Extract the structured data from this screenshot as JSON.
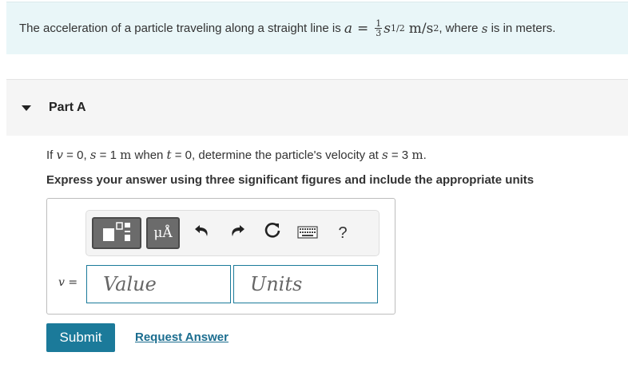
{
  "intro": {
    "prefix": "The acceleration of a particle traveling along a straight line is",
    "eq_var": "a",
    "eq_sign": "=",
    "frac_num": "1",
    "frac_den": "3",
    "eq_s": "s",
    "eq_exp": "1/2",
    "eq_units_m": "m/s",
    "eq_units_exp": "2",
    "suffix_a": ", where",
    "suffix_var": "s",
    "suffix_b": "is in meters."
  },
  "part": {
    "title": "Part A"
  },
  "question": {
    "t1": "If",
    "v": "v",
    "t2": "= 0,",
    "s": "s",
    "t3": "= 1",
    "m1": "m",
    "t4": "when",
    "t": "t",
    "t5": "= 0, determine the particle's velocity at",
    "s2": "s",
    "t6": "= 3",
    "m2": "m",
    "t7": "."
  },
  "instruction": "Express your answer using three significant figures and include the appropriate units",
  "answer": {
    "var_label": "v =",
    "value_placeholder": "Value",
    "units_placeholder": "Units",
    "toolbar": {
      "units_btn_label": "μÅ",
      "help_label": "?"
    }
  },
  "buttons": {
    "submit": "Submit",
    "request": "Request Answer"
  },
  "icons": [
    "templates-icon",
    "units-icon",
    "undo-icon",
    "redo-icon",
    "reset-icon",
    "keyboard-icon",
    "help-icon",
    "caret-down-icon"
  ],
  "colors": {
    "accent": "#1b7a9a",
    "intro_bg": "#e9f6f8",
    "part_bg": "#f5f5f5"
  }
}
